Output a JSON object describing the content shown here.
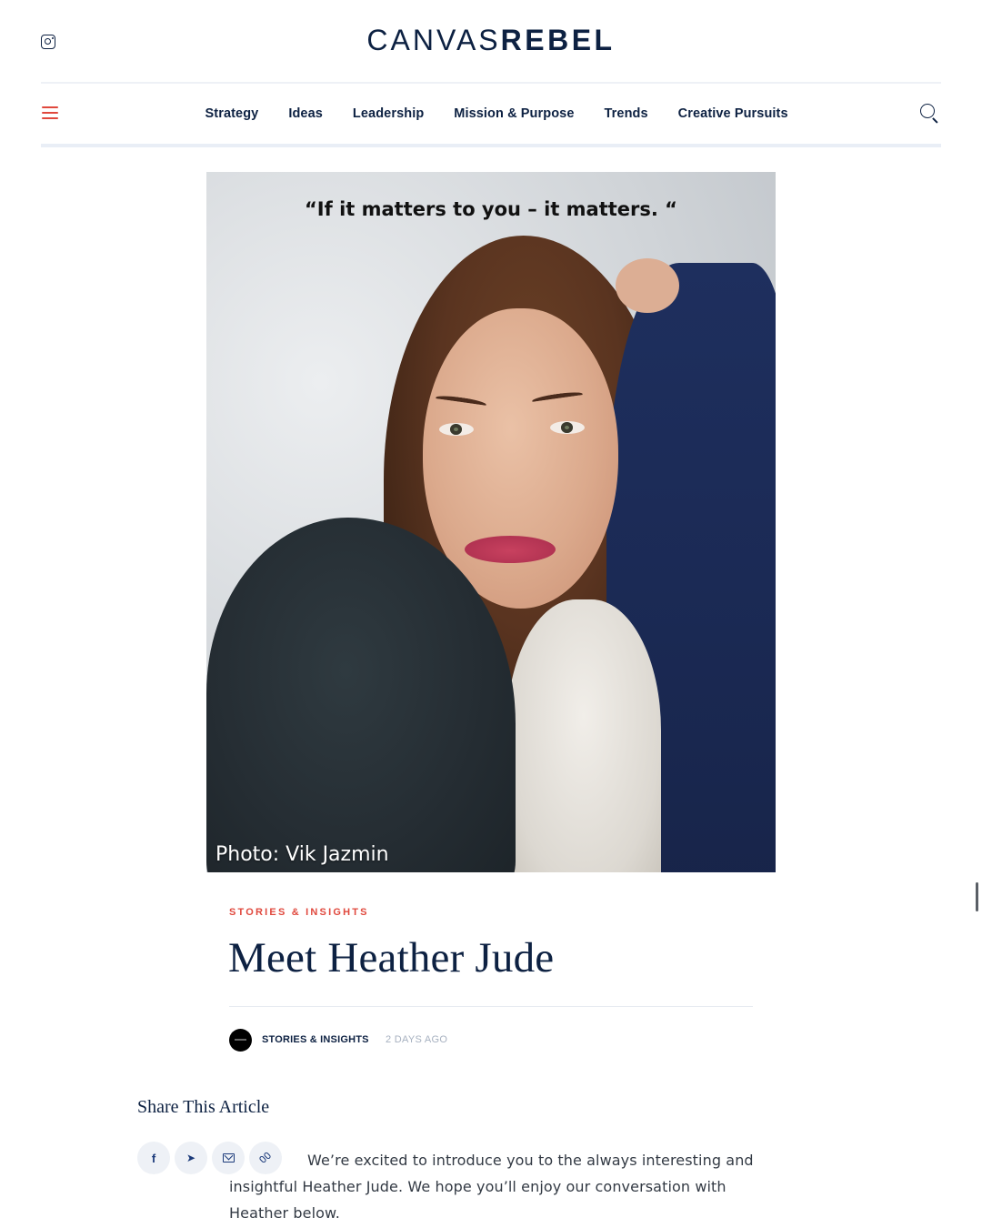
{
  "header": {
    "logo_light": "CANVAS",
    "logo_bold": "REBEL",
    "social_icon": "instagram-icon"
  },
  "nav": {
    "menu_icon": "hamburger-icon",
    "links": [
      "Strategy",
      "Ideas",
      "Leadership",
      "Mission & Purpose",
      "Trends",
      "Creative Pursuits"
    ],
    "search_icon": "search-icon"
  },
  "hero": {
    "quote": "“If it matters to you – it matters. “",
    "credit": "Photo: Vik Jazmin"
  },
  "article": {
    "category": "STORIES & INSIGHTS",
    "title": "Meet Heather Jude",
    "author_label": "STORIES & INSIGHTS",
    "time": "2 DAYS AGO",
    "intro": "We’re excited to introduce you to the always interesting and insightful Heather Jude. We hope you’ll enjoy our conversation with Heather below."
  },
  "share": {
    "title": "Share This Article",
    "buttons": [
      {
        "name": "facebook-icon",
        "glyph": "f"
      },
      {
        "name": "twitter-icon",
        "glyph": "🐦"
      },
      {
        "name": "email-icon",
        "glyph": ""
      },
      {
        "name": "link-icon",
        "glyph": ""
      }
    ]
  },
  "colors": {
    "brand_navy": "#0d2142",
    "accent_red": "#e0483d",
    "muted": "#a7b1c0"
  }
}
